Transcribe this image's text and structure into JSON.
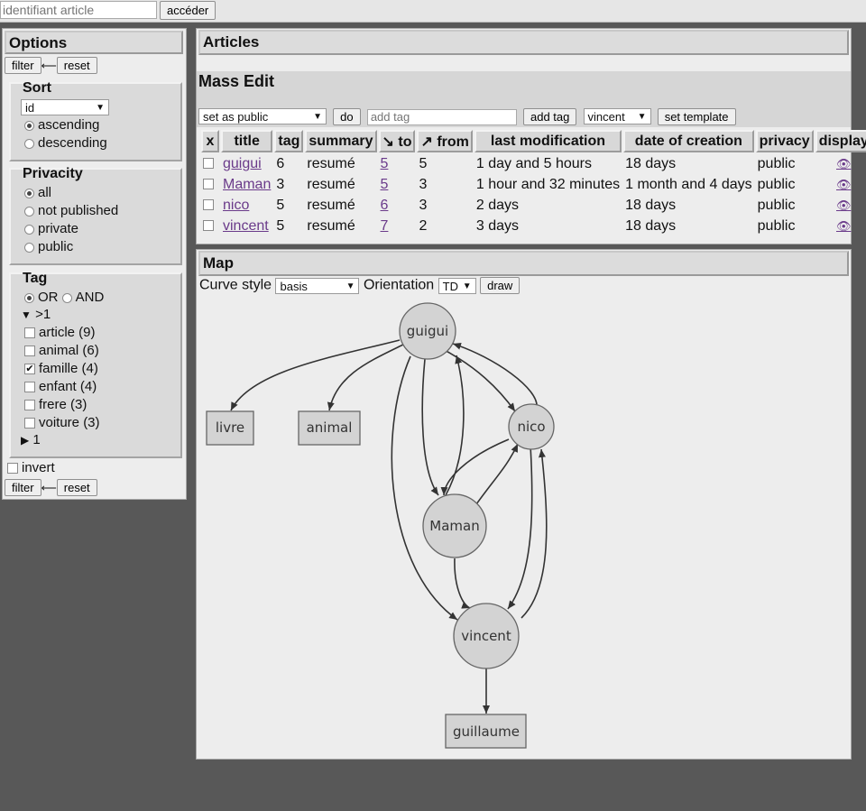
{
  "topbar": {
    "placeholder": "identifiant article",
    "access_label": "accéder"
  },
  "options": {
    "title": "Options",
    "filter_label": "filter",
    "reset_label": "reset",
    "sort": {
      "title": "Sort",
      "field": "id",
      "ascending": "ascending",
      "descending": "descending"
    },
    "privacity": {
      "title": "Privacity",
      "all": "all",
      "not_published": "not published",
      "private": "private",
      "public": "public"
    },
    "tag": {
      "title": "Tag",
      "or": "OR",
      "and": "AND",
      "group1": ">1",
      "items": [
        "article (9)",
        "animal (6)",
        "famille (4)",
        "enfant (4)",
        "frere (3)",
        "voiture (3)"
      ],
      "group2": "1"
    },
    "invert": "invert"
  },
  "articles": {
    "title": "Articles",
    "mass_edit": "Mass Edit",
    "action_select": "set as public",
    "do_label": "do",
    "tag_placeholder": "add tag",
    "add_tag_label": "add tag",
    "template_select": "vincent",
    "set_template_label": "set template",
    "columns": [
      "x",
      "title",
      "tag",
      "summary",
      "↘ to",
      "↗ from",
      "last modification",
      "date of creation",
      "privacy",
      "display"
    ],
    "rows": [
      {
        "title": "guigui",
        "tag": "6",
        "summary": "resumé",
        "to": "5",
        "from": "5",
        "last": "1 day and 5 hours",
        "created": "18 days",
        "privacy": "public"
      },
      {
        "title": "Maman",
        "tag": "3",
        "summary": "resumé",
        "to": "5",
        "from": "3",
        "last": "1 hour and 32 minutes",
        "created": "1 month and 4 days",
        "privacy": "public"
      },
      {
        "title": "nico",
        "tag": "5",
        "summary": "resumé",
        "to": "6",
        "from": "3",
        "last": "2 days",
        "created": "18 days",
        "privacy": "public"
      },
      {
        "title": "vincent",
        "tag": "5",
        "summary": "resumé",
        "to": "7",
        "from": "2",
        "last": "3 days",
        "created": "18 days",
        "privacy": "public"
      }
    ],
    "display_icon": "👁"
  },
  "map": {
    "title": "Map",
    "curve_label": "Curve style",
    "curve_value": "basis",
    "orientation_label": "Orientation",
    "orientation_value": "TD",
    "draw_label": "draw",
    "nodes": {
      "guigui": "guigui",
      "livre": "livre",
      "animal": "animal",
      "nico": "nico",
      "maman": "Maman",
      "vincent": "vincent",
      "guillaume": "guillaume"
    }
  }
}
